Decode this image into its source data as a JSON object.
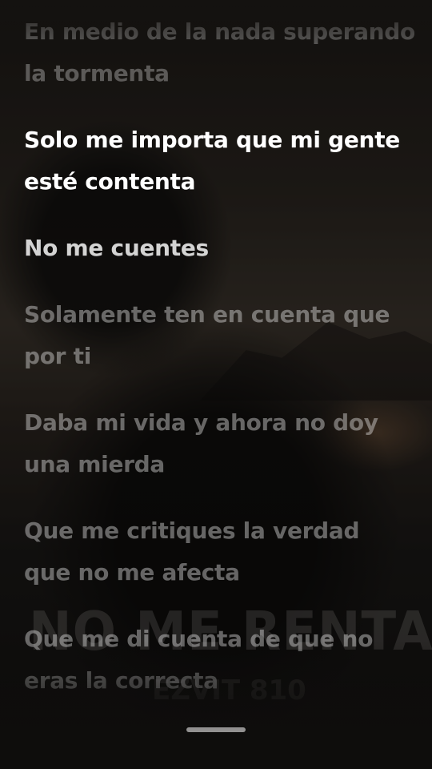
{
  "background": {
    "song_title": "NO ME RENTA",
    "artist": "EZVIT 810"
  },
  "lyrics": [
    {
      "state": "past",
      "lines": [
        "En medio de la nada superando",
        "la tormenta"
      ]
    },
    {
      "state": "active",
      "lines": [
        "Solo me importa que mi gente",
        "esté contenta"
      ]
    },
    {
      "state": "next",
      "lines": [
        "No me cuentes"
      ]
    },
    {
      "state": "upcoming",
      "lines": [
        "Solamente ten en cuenta que",
        "por ti"
      ]
    },
    {
      "state": "upcoming",
      "lines": [
        "Daba mi vida y ahora no doy",
        "una mierda"
      ]
    },
    {
      "state": "upcoming",
      "lines": [
        "Que me critiques la verdad",
        "que no me afecta"
      ]
    },
    {
      "state": "upcoming",
      "lines": [
        "Que me di cuenta de que no",
        "eras la correcta"
      ]
    }
  ],
  "colors": {
    "active_text": "#ffffff",
    "inactive_text": "rgba(255,255,255,0.32)"
  }
}
